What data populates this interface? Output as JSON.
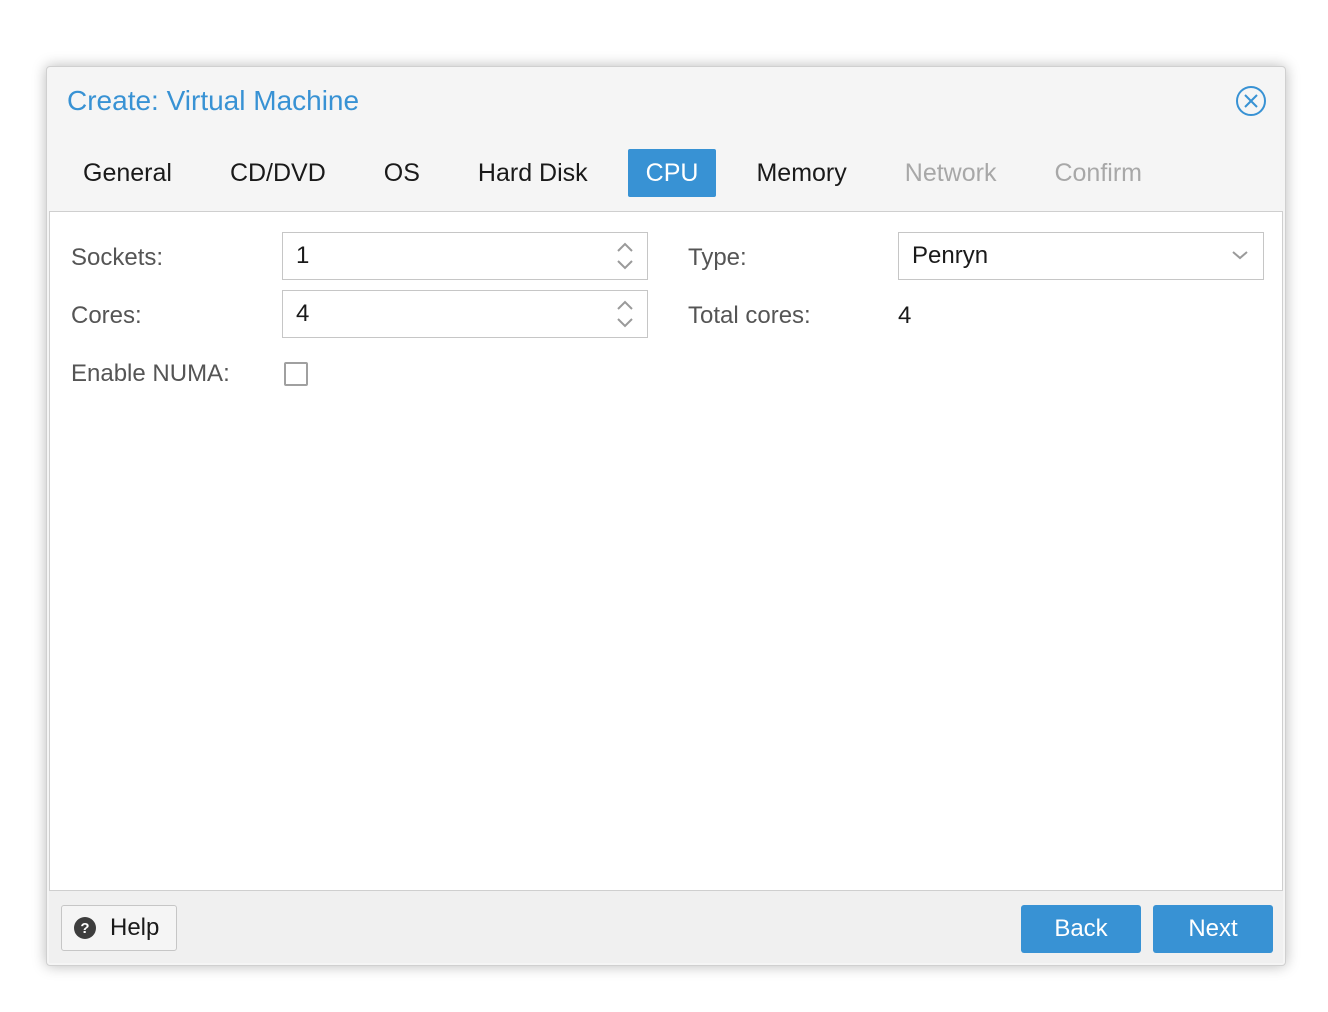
{
  "dialog": {
    "title": "Create: Virtual Machine"
  },
  "tabs": [
    {
      "label": "General",
      "state": "enabled"
    },
    {
      "label": "CD/DVD",
      "state": "enabled"
    },
    {
      "label": "OS",
      "state": "enabled"
    },
    {
      "label": "Hard Disk",
      "state": "enabled"
    },
    {
      "label": "CPU",
      "state": "active"
    },
    {
      "label": "Memory",
      "state": "enabled"
    },
    {
      "label": "Network",
      "state": "disabled"
    },
    {
      "label": "Confirm",
      "state": "disabled"
    }
  ],
  "form": {
    "sockets_label": "Sockets:",
    "sockets_value": "1",
    "cores_label": "Cores:",
    "cores_value": "4",
    "numa_label": "Enable NUMA:",
    "numa_checked": false,
    "type_label": "Type:",
    "type_value": "Penryn",
    "total_cores_label": "Total cores:",
    "total_cores_value": "4"
  },
  "footer": {
    "help_label": "Help",
    "back_label": "Back",
    "next_label": "Next"
  },
  "colors": {
    "accent": "#3892d4",
    "disabled_text": "#a8a8a8",
    "label_text": "#555555"
  },
  "icons": {
    "close": "close-circle-icon",
    "help": "question-circle-icon",
    "spinner": "spinner-arrows-icon",
    "dropdown": "chevron-down-icon"
  }
}
